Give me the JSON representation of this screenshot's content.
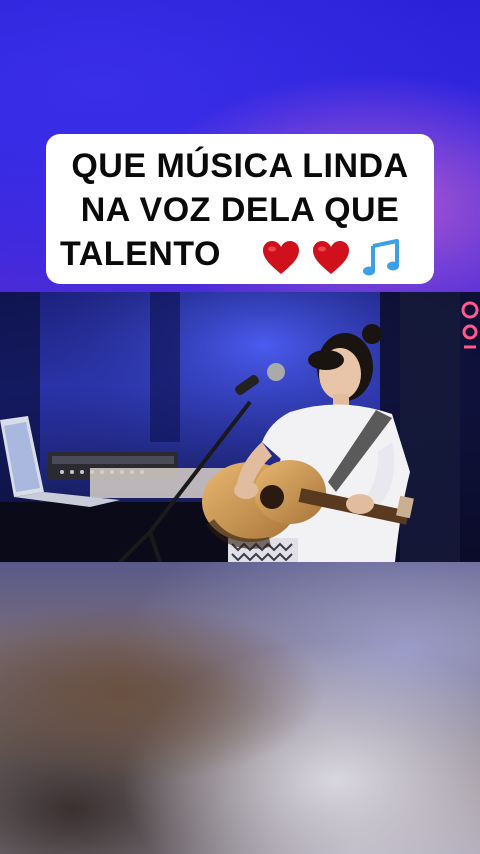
{
  "caption": {
    "line1": "QUE MÚSICA LINDA",
    "line2": "NA VOZ DELA QUE",
    "line3": "TALENTO"
  },
  "icons": {
    "heart_color": "#d0101a",
    "notes_color": "#3aa0e8",
    "emoji_sequence": [
      "heart-icon",
      "heart-icon",
      "music-notes-icon"
    ]
  },
  "colors": {
    "backdrop_blue": "#2a22d8",
    "caption_bg": "#ffffff",
    "caption_text": "#0a0a0a"
  }
}
